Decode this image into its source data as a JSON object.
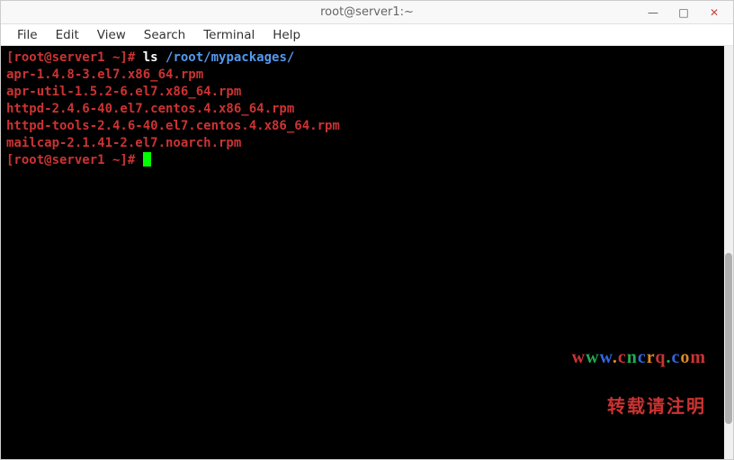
{
  "window": {
    "title": "root@server1:~"
  },
  "menu": {
    "file": "File",
    "edit": "Edit",
    "view": "View",
    "search": "Search",
    "terminal": "Terminal",
    "help": "Help"
  },
  "prompt1": {
    "text": "[root@server1 ~]# ",
    "command": "ls ",
    "path": "/root/mypackages/"
  },
  "output": {
    "line1": "apr-1.4.8-3.el7.x86_64.rpm",
    "line2": "apr-util-1.5.2-6.el7.x86_64.rpm",
    "line3": "httpd-2.4.6-40.el7.centos.4.x86_64.rpm",
    "line4": "httpd-tools-2.4.6-40.el7.centos.4.x86_64.rpm",
    "line5": "mailcap-2.1.41-2.el7.noarch.rpm"
  },
  "prompt2": {
    "text": "[root@server1 ~]# "
  },
  "watermark": {
    "url": "www.cncrq.com",
    "note": "转载请注明"
  },
  "controls": {
    "min": "—",
    "max": "□",
    "close": "✕"
  }
}
